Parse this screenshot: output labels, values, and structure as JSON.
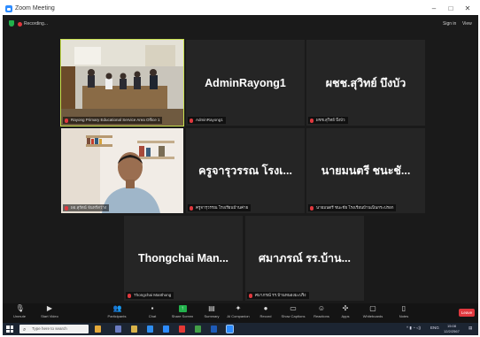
{
  "window": {
    "title": "Zoom Meeting",
    "minimize": "–",
    "maximize": "□",
    "close": "✕"
  },
  "top_bar": {
    "recording_label": "Recording...",
    "sign_in_label": "Sign in",
    "view_label": "View"
  },
  "tiles": [
    {
      "id": "meeting-room",
      "display_name": "",
      "name_tag": "Rayong Primary Educational Service Area Office 1"
    },
    {
      "id": "admin",
      "display_name": "AdminRayong1",
      "name_tag": "AdminRayong1"
    },
    {
      "id": "sawit",
      "display_name": "ผชช.สุวิทย์ บึงบัว",
      "name_tag": "ผชช.สุวิทย์ บึงบัว"
    },
    {
      "id": "man-video",
      "display_name": "",
      "name_tag": "ผอ.สุรัตน์ จันทร์สว่าง"
    },
    {
      "id": "krujaruwan",
      "display_name": "ครูจารุวรรณ โรงเ...",
      "name_tag": "ครูจารุวรรณ โรงเรียนบ้านค่าย"
    },
    {
      "id": "manatree",
      "display_name": "นายมนตรี ชนะชั...",
      "name_tag": "นายมนตรี ชนะชัย โรงเรียนบ้านเนินกระปรอก"
    },
    {
      "id": "thongchai",
      "display_name": "Thongchai Man...",
      "name_tag": "Thongchai Manthong"
    },
    {
      "id": "samaporn",
      "display_name": "ศมาภรณ์ รร.บ้าน...",
      "name_tag": "ศมาภรณ์ รร.บ้านหนองมะปริง"
    }
  ],
  "toolbar": {
    "unmute": "Unmute",
    "start_video": "Start Video",
    "participants": "Participants",
    "participant_count": "8",
    "chat": "Chat",
    "share_screen": "Share Screen",
    "summary": "Summary",
    "ai_companion": "AI Companion",
    "record": "Record",
    "show_captions": "Show Captions",
    "reactions": "Reactions",
    "apps": "Apps",
    "whiteboards": "Whiteboards",
    "notes": "Notes",
    "leave": "Leave"
  },
  "taskbar": {
    "search_placeholder": "Type here to search",
    "language": "ENG",
    "time": "15:08",
    "date": "12/2/2567"
  },
  "colors": {
    "accent_zoom": "#2d8cff",
    "active_speaker": "#c8e04d",
    "leave": "#e0383e",
    "mic_muted": "#e0383e",
    "share": "#22b24c"
  }
}
